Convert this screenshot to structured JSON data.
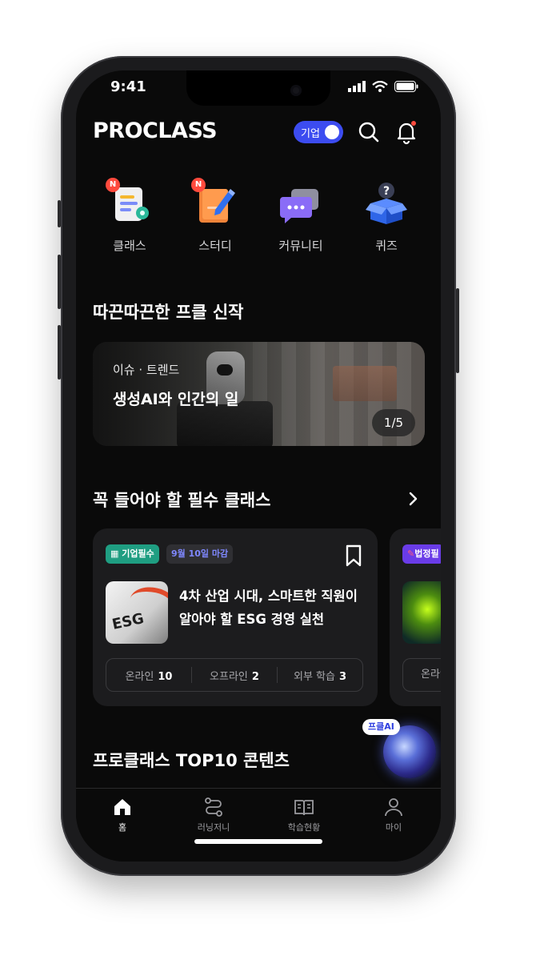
{
  "status_bar": {
    "time": "9:41"
  },
  "header": {
    "logo": "PROCLASS",
    "toggle_label": "기업"
  },
  "menu": [
    {
      "label": "클래스",
      "badge": "N",
      "icon": "class-icon"
    },
    {
      "label": "스터디",
      "badge": "N",
      "icon": "study-icon"
    },
    {
      "label": "커뮤니티",
      "icon": "community-icon"
    },
    {
      "label": "퀴즈",
      "icon": "quiz-icon"
    }
  ],
  "new_section": {
    "title": "따끈따끈한 프클 신작",
    "banner": {
      "tag": "이슈 · 트렌드",
      "title": "생성AI와 인간의 일",
      "pager": "1/5"
    }
  },
  "required_section": {
    "title": "꼭 들어야 할 필수 클래스",
    "card": {
      "badge_type": "기업필수",
      "badge_deadline": "9월 10일 마감",
      "title": "4차 산업 시대, 스마트한 직원이 알아야 할 ESG 경영 실천",
      "thumb_text": "ESG",
      "stats": [
        {
          "label": "온라인",
          "value": "10"
        },
        {
          "label": "오프라인",
          "value": "2"
        },
        {
          "label": "외부 학습",
          "value": "3"
        }
      ]
    },
    "card2": {
      "badge_type": "법정필",
      "stat_label": "온라인"
    }
  },
  "top10_section": {
    "title": "프로클래스 TOP10 콘텐츠"
  },
  "ai_button": {
    "label": "프클AI"
  },
  "tabbar": [
    {
      "label": "홈",
      "icon": "home-icon",
      "active": true
    },
    {
      "label": "러닝저니",
      "icon": "journey-icon"
    },
    {
      "label": "학습현황",
      "icon": "book-icon"
    },
    {
      "label": "마이",
      "icon": "person-icon"
    }
  ],
  "colors": {
    "accent": "#3c4cf0",
    "badge_red": "#ff4a3d",
    "green_badge": "#1f9e82",
    "background": "#0a0a0a"
  }
}
